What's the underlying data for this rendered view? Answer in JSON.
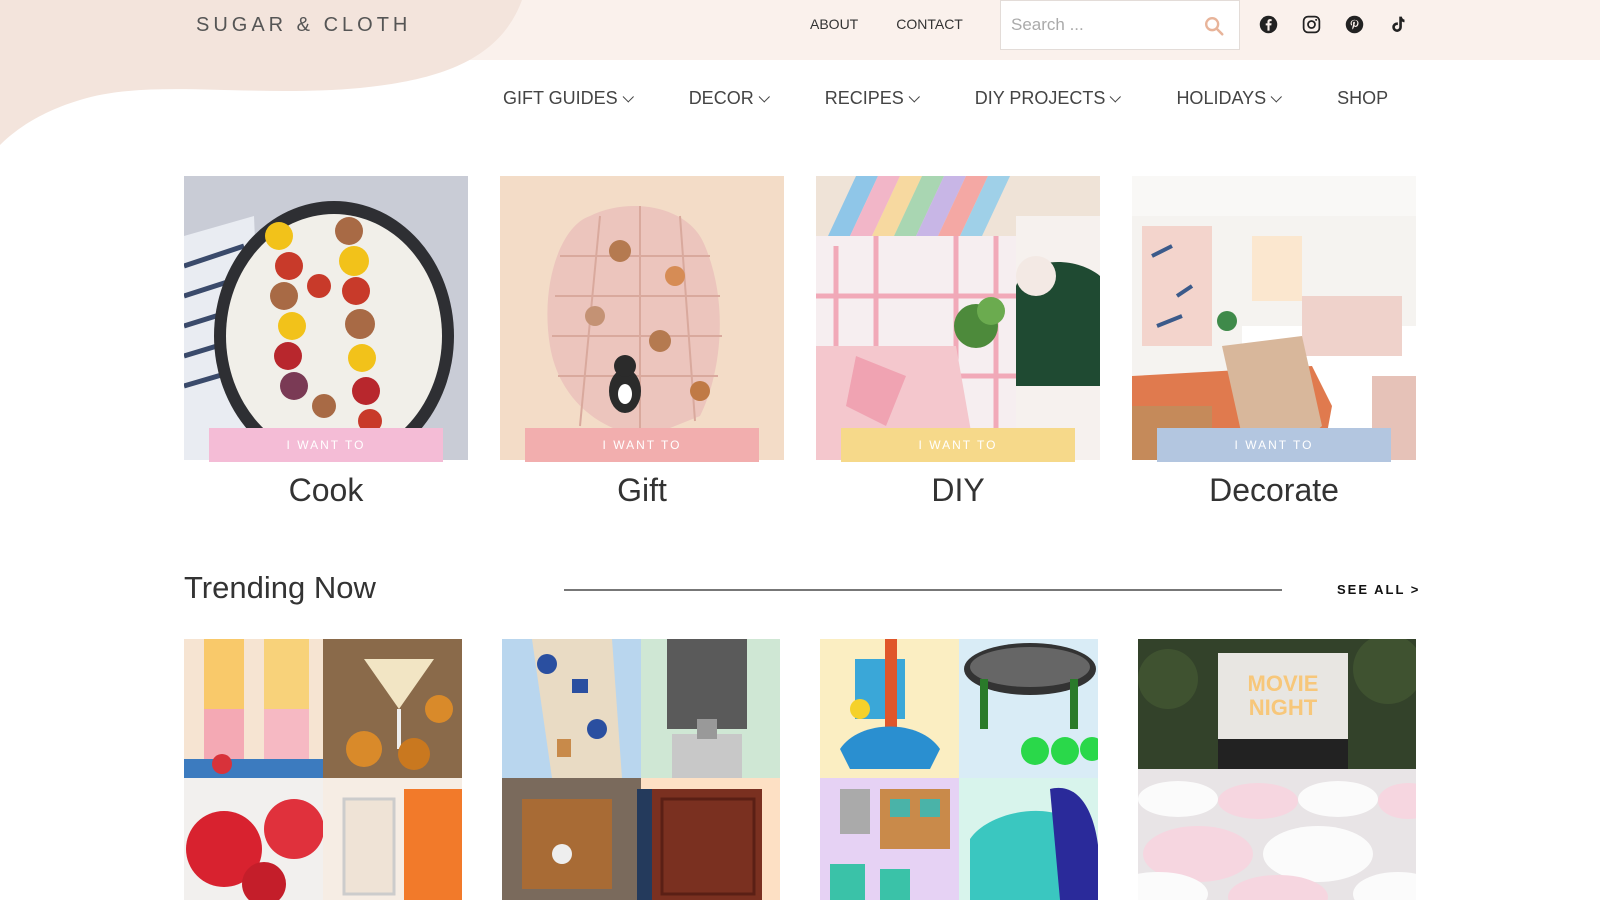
{
  "brand": {
    "logo_text": "SUGAR & CLOTH"
  },
  "toplinks": {
    "about": "ABOUT",
    "contact": "CONTACT"
  },
  "search": {
    "placeholder": "Search ..."
  },
  "social_icons": [
    "facebook-icon",
    "instagram-icon",
    "pinterest-icon",
    "tiktok-icon"
  ],
  "nav": {
    "items": [
      {
        "label": "GIFT GUIDES",
        "dropdown": true
      },
      {
        "label": "DECOR",
        "dropdown": true
      },
      {
        "label": "RECIPES",
        "dropdown": true
      },
      {
        "label": "DIY PROJECTS",
        "dropdown": true
      },
      {
        "label": "HOLIDAYS",
        "dropdown": true
      },
      {
        "label": "SHOP",
        "dropdown": false
      }
    ]
  },
  "categories": [
    {
      "kicker": "I WANT TO",
      "title": "Cook",
      "pill_color": "#f4bcd6"
    },
    {
      "kicker": "I WANT TO",
      "title": "Gift",
      "pill_color": "#f2aeae"
    },
    {
      "kicker": "I WANT TO",
      "title": "DIY",
      "pill_color": "#f6d98a"
    },
    {
      "kicker": "I WANT TO",
      "title": "Decorate",
      "pill_color": "#b3c6e0"
    }
  ],
  "trending": {
    "heading": "Trending Now",
    "see_all": "SEE ALL >",
    "movie_screen_text": "MOVIE NIGHT"
  },
  "colors": {
    "header_bg": "#faf1ec",
    "blob": "#f3e4dc",
    "search_icon": "#e8b49a"
  }
}
